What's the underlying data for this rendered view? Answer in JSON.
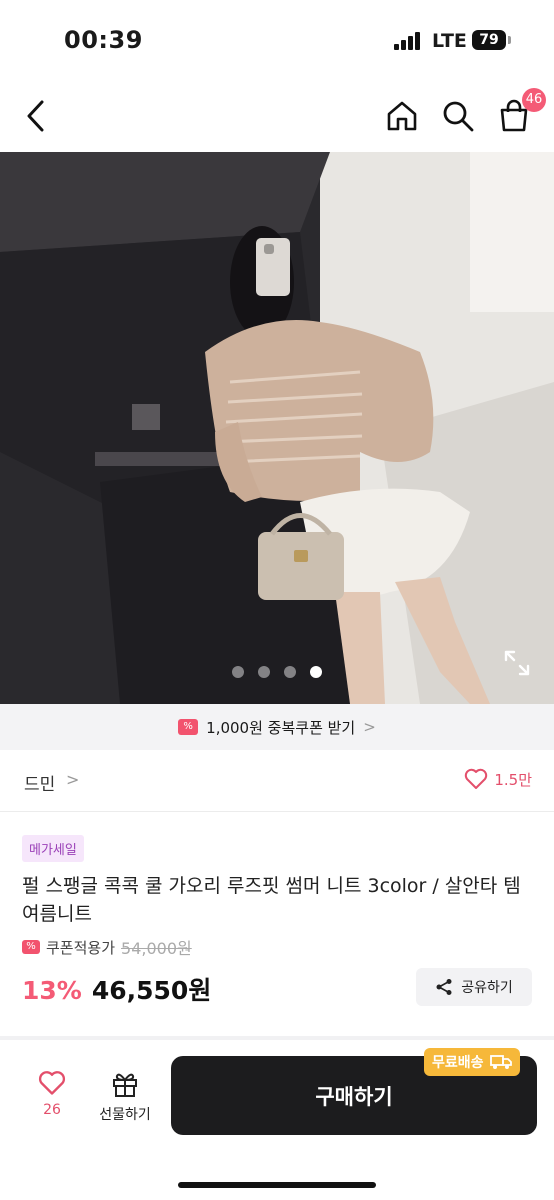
{
  "status_bar": {
    "time": "00:39",
    "network": "LTE",
    "battery": "79"
  },
  "nav": {
    "cart_count": "46"
  },
  "gallery": {
    "total": 4,
    "active_index": 3
  },
  "coupon_banner": {
    "text": "1,000원 중복쿠폰 받기",
    "chevron": ">"
  },
  "store": {
    "name": "드민",
    "chevron": ">",
    "likes": "1.5만"
  },
  "product": {
    "tag": "메가세일",
    "title": "펄 스팽글 콕콕 쿨 가오리 루즈핏 썸머 니트 3color / 살안타 템 여름니트",
    "coupon_label": "쿠폰적용가",
    "original_price": "54,000원",
    "discount": "13%",
    "price": "46,550원",
    "share_label": "공유하기"
  },
  "bottom_bar": {
    "like_count": "26",
    "gift_label": "선물하기",
    "buy_label": "구매하기",
    "free_shipping_label": "무료배송"
  },
  "colors": {
    "accent": "#f45b76",
    "buy_button": "#1c1c1e",
    "free_ship_badge": "#f6b83a",
    "mega_tag_bg": "#f6e6fb"
  }
}
